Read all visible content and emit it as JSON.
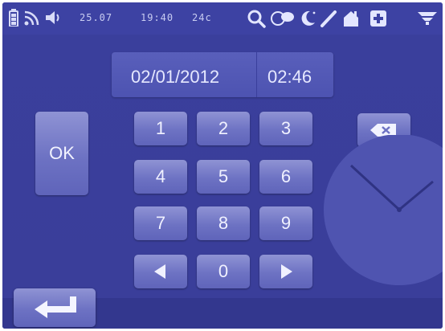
{
  "status_bar": {
    "date": "25.07",
    "time": "19:40",
    "temperature": "24c"
  },
  "datetime_panel": {
    "date_value": "02/01/2012",
    "time_value": "02:46"
  },
  "keypad": {
    "keys": [
      "1",
      "2",
      "3",
      "4",
      "5",
      "6",
      "7",
      "8",
      "9",
      "0"
    ]
  },
  "buttons": {
    "ok_label": "OK"
  },
  "icons": {
    "battery": "battery-icon",
    "wifi": "wifi-icon",
    "volume": "speaker-icon",
    "search": "search-icon",
    "chat": "chat-bubble-icon",
    "night": "moon-icon",
    "edit": "pencil-icon",
    "home": "home-icon",
    "add": "plus-icon",
    "signal": "signal-icon",
    "backspace": "backspace-icon",
    "left": "arrow-left-icon",
    "right": "arrow-right-icon",
    "enter": "enter-return-icon",
    "clock": "clock-icon"
  },
  "colors": {
    "background": "#3a3f9c",
    "button": "#6d72c3",
    "text": "#e6e8ff"
  }
}
